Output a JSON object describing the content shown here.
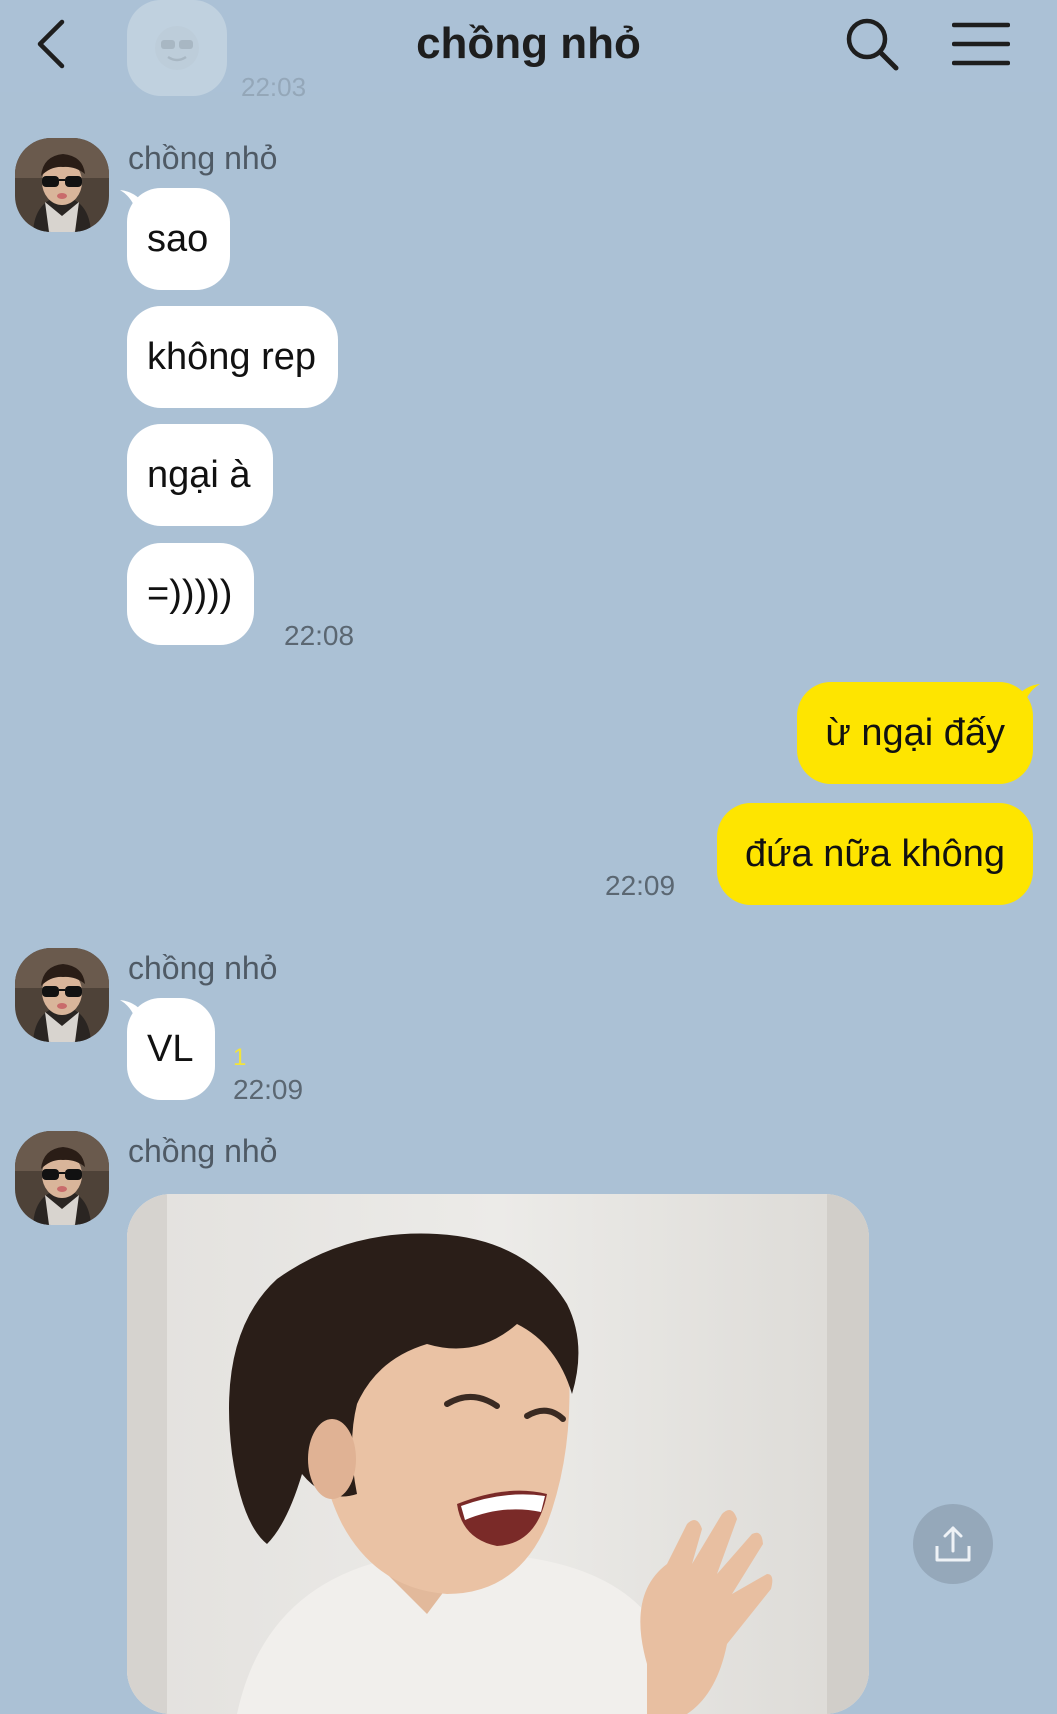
{
  "header": {
    "title": "chồng nhỏ",
    "back_icon": "chevron-left-icon",
    "search_icon": "search-icon",
    "menu_icon": "hamburger-menu-icon"
  },
  "previous": {
    "time": "22:03"
  },
  "messages": [
    {
      "sender": "chồng nhỏ",
      "direction": "incoming",
      "bubbles": [
        "sao",
        "không rep",
        "ngại à",
        "=)))))"
      ],
      "time": "22:08"
    },
    {
      "direction": "outgoing",
      "bubbles": [
        "ừ ngại đấy",
        "đứa nữa không"
      ],
      "time": "22:09"
    },
    {
      "sender": "chồng nhỏ",
      "direction": "incoming",
      "bubbles": [
        "VL"
      ],
      "unread_count": "1",
      "time": "22:09"
    },
    {
      "sender": "chồng nhỏ",
      "direction": "incoming",
      "type": "photo"
    }
  ],
  "colors": {
    "background": "#abc1d5",
    "incoming_bubble": "#ffffff",
    "outgoing_bubble": "#fee500",
    "unread": "#f2e43c"
  },
  "share_icon": "share-upload-icon"
}
